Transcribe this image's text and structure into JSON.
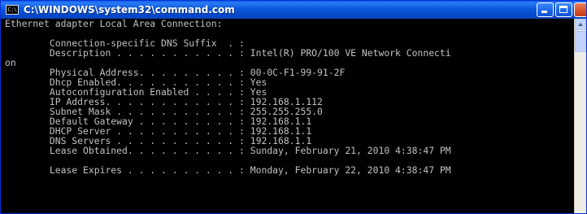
{
  "window": {
    "title": "C:\\WINDOWS\\system32\\command.com",
    "icon_text": "C:\\",
    "icon": "console-icon"
  },
  "console": {
    "lines": [
      "Ethernet adapter Local Area Connection:",
      "",
      "        Connection-specific DNS Suffix  . :",
      "        Description . . . . . . . . . . . : Intel(R) PRO/100 VE Network Connecti",
      "on",
      "        Physical Address. . . . . . . . . : 00-0C-F1-99-91-2F",
      "        Dhcp Enabled. . . . . . . . . . . : Yes",
      "        Autoconfiguration Enabled . . . . : Yes",
      "        IP Address. . . . . . . . . . . . : 192.168.1.112",
      "        Subnet Mask . . . . . . . . . . . : 255.255.255.0",
      "        Default Gateway . . . . . . . . . : 192.168.1.1",
      "        DHCP Server . . . . . . . . . . . : 192.168.1.1",
      "        DNS Servers . . . . . . . . . . . : 192.168.1.1",
      "        Lease Obtained. . . . . . . . . . : Sunday, February 21, 2010 4:38:47 PM",
      "",
      "        Lease Expires . . . . . . . . . . : Monday, February 22, 2010 4:38:47 PM"
    ]
  },
  "colors": {
    "console_bg": "#000000",
    "console_text": "#c0c0c0",
    "titlebar": "#0a58dc"
  }
}
